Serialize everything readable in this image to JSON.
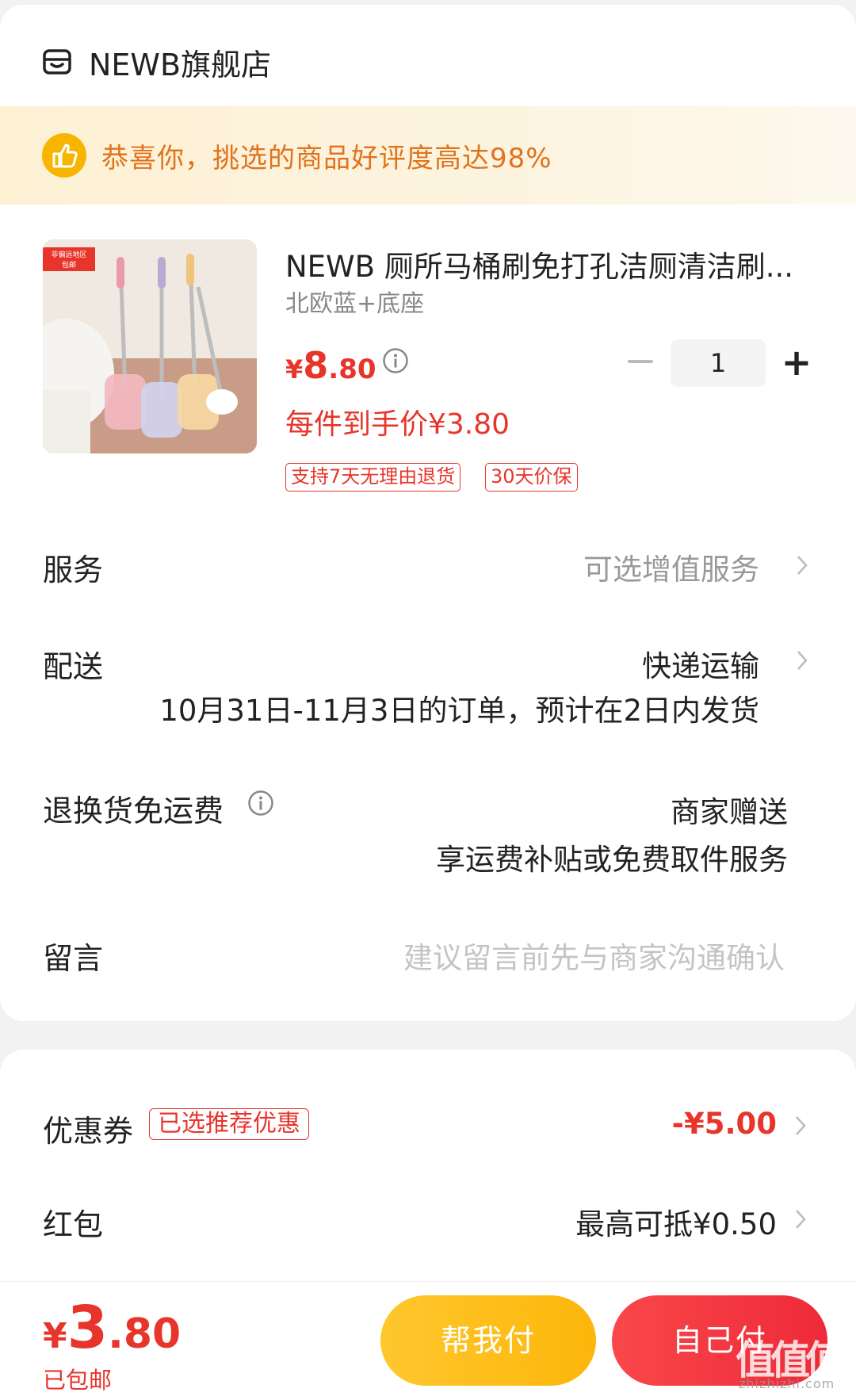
{
  "store": {
    "name": "NEWB旗舰店",
    "icon": "store-icon"
  },
  "praise": {
    "text": "恭喜你，挑选的商品好评度高达98%",
    "icon": "thumbs-up-icon"
  },
  "product": {
    "image_badge": "非偏远地区包邮",
    "title": "NEWB 厕所马桶刷免打孔洁厕清洁刷...",
    "variant": "北欧蓝+底座",
    "price_currency": "¥",
    "price_int": "8",
    "price_dec": ".80",
    "per_item_price": "每件到手价¥3.80",
    "quantity": "1",
    "tags": [
      "支持7天无理由退货",
      "30天价保"
    ]
  },
  "rows": {
    "service": {
      "label": "服务",
      "value": "可选增值服务"
    },
    "delivery": {
      "label": "配送",
      "value": "快递运输",
      "note": "10月31日-11月3日的订单，预计在2日内发货"
    },
    "return_shipping": {
      "label": "退换货免运费",
      "value": "商家赠送",
      "note": "享运费补贴或免费取件服务"
    },
    "message": {
      "label": "留言",
      "placeholder": "建议留言前先与商家沟通确认"
    }
  },
  "discounts": {
    "coupon": {
      "label": "优惠券",
      "badge": "已选推荐优惠",
      "value": "-¥5.00"
    },
    "red_packet": {
      "label": "红包",
      "value": "最高可抵¥0.50"
    }
  },
  "checkout": {
    "total_currency": "¥",
    "total_int": "3",
    "total_dec": ".80",
    "shipping_note": "已包邮",
    "help_pay_label": "帮我付",
    "self_pay_label": "自己付"
  },
  "watermark": {
    "main": "值值值",
    "sub": "zhizhizhi.com"
  },
  "colors": {
    "accent_red": "#e8352c",
    "praise_orange": "#e0731c",
    "help_button": "#fdb60a",
    "self_button": "#ee2a39"
  }
}
